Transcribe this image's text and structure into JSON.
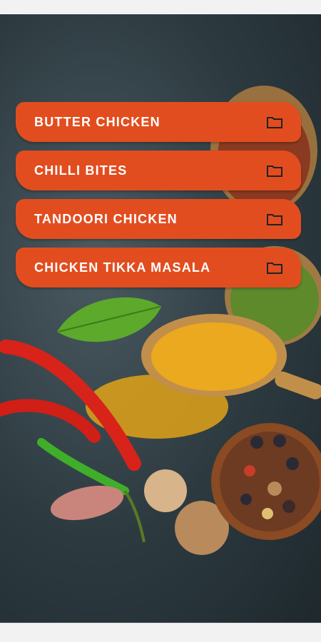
{
  "menu": {
    "items": [
      {
        "label": "BUTTER CHICKEN",
        "icon": "folder-icon"
      },
      {
        "label": "CHILLI BITES",
        "icon": "folder-icon"
      },
      {
        "label": "TANDOORI CHICKEN",
        "icon": "folder-icon"
      },
      {
        "label": "CHICKEN TIKKA MASALA",
        "icon": "folder-icon"
      }
    ]
  },
  "colors": {
    "accent": "#e24d1f",
    "background": "#2c3a40",
    "label_text": "#ffffff"
  },
  "background_image": "spices-photo"
}
